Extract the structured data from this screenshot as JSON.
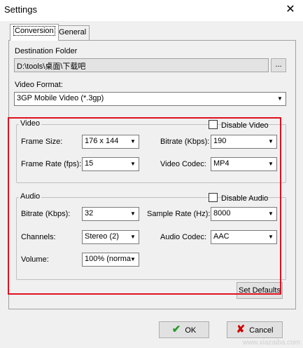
{
  "window": {
    "title": "Settings",
    "close_glyph": "✕"
  },
  "tabs": [
    {
      "label": "Conversion"
    },
    {
      "label": "General"
    }
  ],
  "destination": {
    "label": "Destination Folder",
    "path": "D:\\tools\\桌面\\下载吧",
    "browse_label": "..."
  },
  "video_format": {
    "label": "Video Format:",
    "value": "3GP Mobile Video (*.3gp)"
  },
  "video": {
    "title": "Video",
    "disable_label": "Disable Video",
    "disable_checked": false,
    "frame_size": {
      "label": "Frame Size:",
      "value": "176 x 144"
    },
    "frame_rate": {
      "label": "Frame Rate (fps):",
      "value": "15"
    },
    "bitrate": {
      "label": "Bitrate (Kbps):",
      "value": "190"
    },
    "codec": {
      "label": "Video Codec:",
      "value": "MP4"
    }
  },
  "audio": {
    "title": "Audio",
    "disable_label": "Disable Audio",
    "disable_checked": false,
    "bitrate": {
      "label": "Bitrate (Kbps):",
      "value": "32"
    },
    "channels": {
      "label": "Channels:",
      "value": "Stereo (2)"
    },
    "volume": {
      "label": "Volume:",
      "value": "100%  (norma"
    },
    "sample_rate": {
      "label": "Sample Rate (Hz):",
      "value": "8000"
    },
    "codec": {
      "label": "Audio Codec:",
      "value": "AAC"
    }
  },
  "buttons": {
    "set_defaults": "Set Defaults",
    "ok": "OK",
    "cancel": "Cancel"
  },
  "watermark": "www.xiazaiba.com",
  "colors": {
    "highlight": "#e01020",
    "ok_icon": "#2a9a2a",
    "cancel_icon": "#d00000"
  },
  "icons": {
    "ok": "check-icon",
    "cancel": "x-icon",
    "dropdown": "chevron-down-icon"
  }
}
